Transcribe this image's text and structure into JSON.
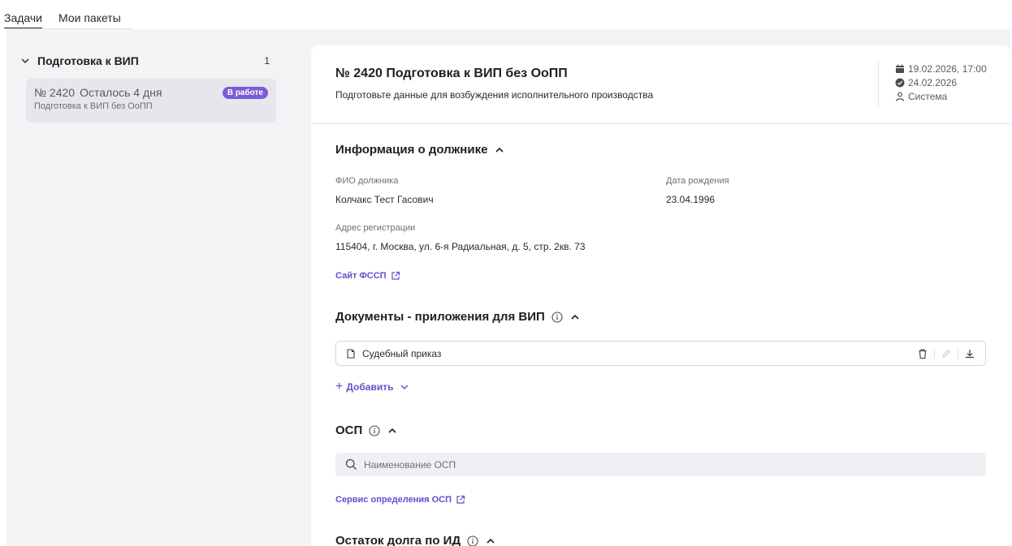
{
  "tabs": [
    {
      "label": "Задачи",
      "active": true
    },
    {
      "label": "Мои пакеты",
      "active": false
    }
  ],
  "sidebar": {
    "group": {
      "title": "Подготовка к ВИП",
      "count": "1"
    },
    "task": {
      "number": "№ 2420",
      "remaining": "Осталось 4 дня",
      "status": "В работе",
      "subtitle": "Подготовка к ВИП без ОоПП"
    }
  },
  "header": {
    "title": "№ 2420 Подготовка к ВИП без ОоПП",
    "description": "Подготовьте данные для возбуждения исполнительного производства",
    "created": "19.02.2026, 17:00",
    "deadline": "24.02.2026",
    "author": "Система"
  },
  "debtor": {
    "section_title": "Информация о должнике",
    "fio_label": "ФИО должника",
    "fio_value": "Колчакс Тест Гасович",
    "birth_label": "Дата рождения",
    "birth_value": "23.04.1996",
    "address_label": "Адрес регистрации",
    "address_value": "115404, г. Москва, ул. 6-я Радиальная, д. 5, стр. 2кв. 73",
    "fssp_link": "Сайт ФССП"
  },
  "documents": {
    "section_title": "Документы - приложения для ВИП",
    "item": "Судебный приказ",
    "add_label": "Добавить"
  },
  "osp": {
    "section_title": "ОСП",
    "search_placeholder": "Наименование ОСП",
    "service_link": "Сервис определения ОСП"
  },
  "debt": {
    "section_title": "Остаток долга по ИД"
  },
  "colors": {
    "accent": "#6a4ad1",
    "badge": "#7b5cd6",
    "background": "#f3f3f6"
  }
}
